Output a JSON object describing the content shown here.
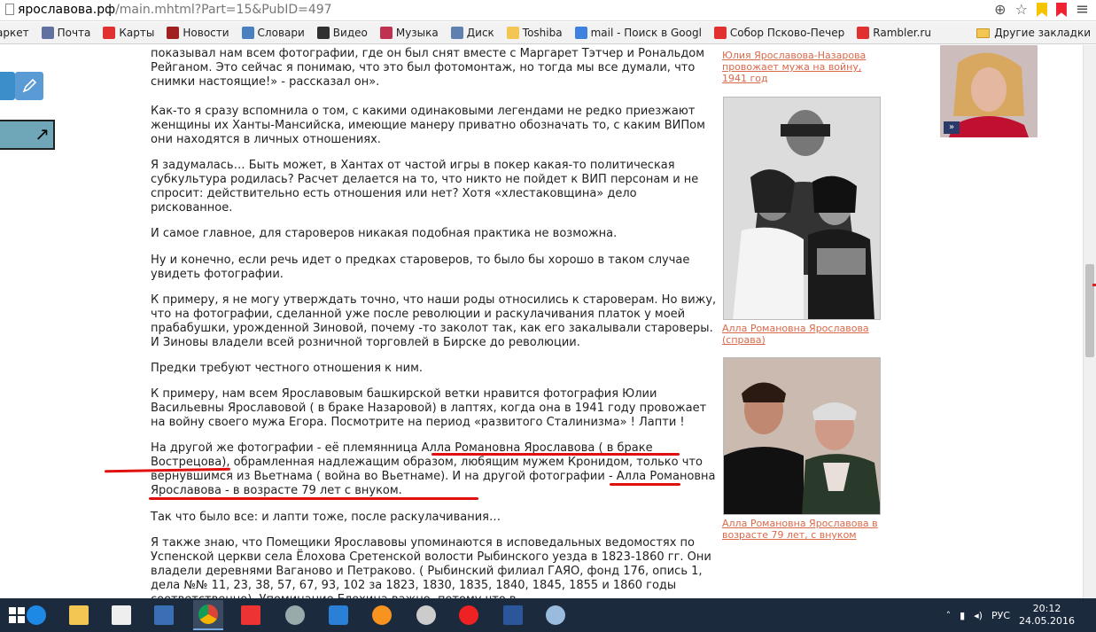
{
  "browser": {
    "url_host": "ярославова.рф",
    "url_path": "/main.mhtml?Part=15&PubID=497",
    "bookmarks": [
      {
        "label": "аркет",
        "color": "#e0a020"
      },
      {
        "label": "Почта",
        "color": "#6070a0"
      },
      {
        "label": "Карты",
        "color": "#e03030"
      },
      {
        "label": "Новости",
        "color": "#a02020"
      },
      {
        "label": "Словари",
        "color": "#4a80c0"
      },
      {
        "label": "Видео",
        "color": "#303030"
      },
      {
        "label": "Музыка",
        "color": "#c03050"
      },
      {
        "label": "Диск",
        "color": "#6080b0"
      },
      {
        "label": "Toshiba",
        "color": "#f3c552"
      },
      {
        "label": "mail - Поиск в Googl",
        "color": "#4080e0"
      },
      {
        "label": "Собор Псково-Печер",
        "color": "#e03030"
      },
      {
        "label": "Rambler.ru",
        "color": "#e03030"
      }
    ],
    "other_bookmarks": "Другие закладки"
  },
  "article": {
    "p1": "показывал нам всем фотографии, где он был снят вместе с Маргарет Тэтчер и Рональдом Рейганом. Это сейчас я понимаю, что это был фотомонтаж, но тогда мы все думали, что снимки настоящие!» - рассказал он».",
    "p2": "Как-то я сразу вспомнила о том, с какими одинаковыми легендами не редко приезжают женщины их Ханты-Мансийска, имеющие манеру приватно обозначать то, с каким ВИПом они находятся в личных отношениях.",
    "p3": "Я задумалась… Быть может, в Хантах от частой игры в покер какая-то политическая субкультура родилась? Расчет делается на то, что никто не пойдет к ВИП персонам и не спросит: действительно есть отношения или нет? Хотя «хлестаковщина» дело рискованное.",
    "p4": "И самое главное, для староверов никакая подобная практика не возможна.",
    "p5": "Ну и конечно, если речь идет о предках староверов, то было бы хорошо в таком случае увидеть фотографии.",
    "p6": "К примеру, я не могу утверждать точно, что наши роды относились к староверам. Но вижу, что на фотографии, сделанной уже после революции и раскулачивания платок у моей прабабушки, урожденной Зиновой, почему -то заколот так, как его закалывали староверы. И Зиновы владели всей розничной торговлей в Бирске до революции.",
    "p7": "Предки требуют честного отношения к ним.",
    "p8": "К примеру, нам всем Ярославовым башкирской ветки нравится фотография Юлии Васильевны Ярославовой ( в браке Назаровой) в лаптях, когда она в 1941 году провожает на войну своего мужа Егора. Посмотрите на период «развитого Сталинизма» ! Лапти !",
    "p9": "На другой же фотографии - её племянница Алла Романовна Ярославова ( в браке Вострецова), обрамленная надлежащим образом, любящим мужем Кронидом, только что вернувшимся из Вьетнама ( война во Вьетнаме). И на другой фотографии - Алла Романовна Ярославова - в возрасте 79 лет с внуком.",
    "p10": "Так что было все: и лапти тоже, после раскулачивания…",
    "p11": "Я также знаю, что Помещики Ярославовы упоминаются в исповедальных ведомостях по Успенской церкви села Ёлохова Сретенской волости Рыбинского уезда в 1823-1860 гг. Они владели деревнями Ваганово и Петраково. ( Рыбинский филиал ГАЯО, фонд 176, опись 1, дела №№ 11, 23, 38, 57, 67, 93, 102 за 1823, 1830, 1835, 1840, 1845, 1855 и 1860 годы соответственно). Упоминание Елохина важно, потому что в"
  },
  "sidebar": {
    "cap1": "Юлия Ярославова-Назарова провожает мужа на войну, 1941 год",
    "cap2": "Алла Романовна Ярославова (справа)",
    "cap3": "Алла Романовна Ярославова в возрасте 79 лет, с внуком"
  },
  "taskbar": {
    "lang": "РУС",
    "time": "20:12",
    "date": "24.05.2016"
  }
}
